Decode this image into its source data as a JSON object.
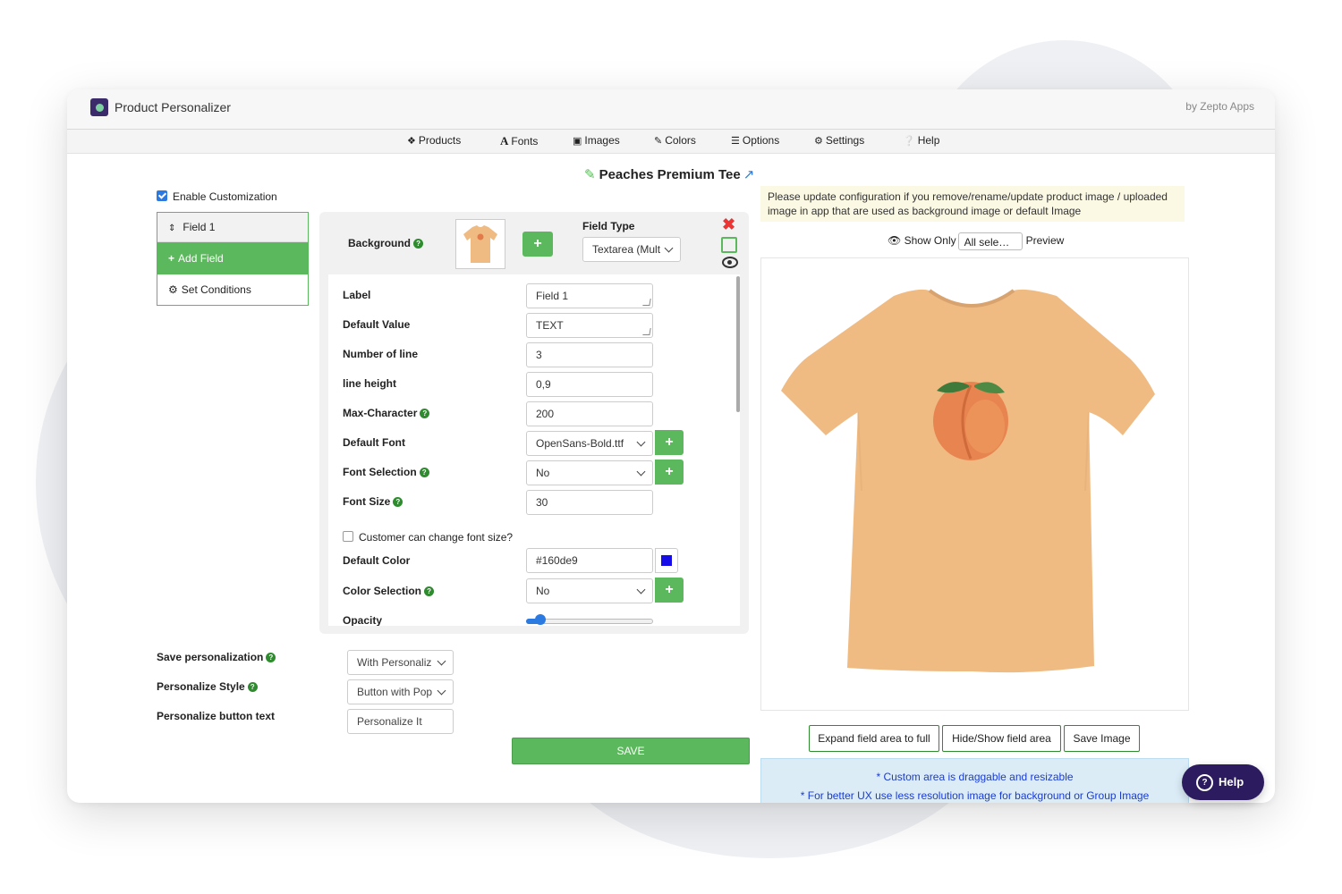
{
  "app": {
    "title": "Product Personalizer",
    "by": "by Zepto Apps"
  },
  "nav": {
    "items": [
      {
        "label": "Products",
        "icon": "cubes-icon"
      },
      {
        "label": "Fonts",
        "icon": "font-icon"
      },
      {
        "label": "Images",
        "icon": "image-icon"
      },
      {
        "label": "Colors",
        "icon": "brush-icon"
      },
      {
        "label": "Options",
        "icon": "list-icon"
      },
      {
        "label": "Settings",
        "icon": "gears-icon"
      },
      {
        "label": "Help",
        "icon": "question-circle-icon"
      }
    ]
  },
  "product": {
    "title": "Peaches Premium Tee"
  },
  "enable_customization": {
    "label": "Enable Customization",
    "checked": true
  },
  "fields_list": {
    "field": "Field 1",
    "add_field": "Add Field",
    "set_conditions": "Set Conditions"
  },
  "editor": {
    "background_label": "Background",
    "field_type_label": "Field Type",
    "field_type_value": "Textarea (Mult",
    "label": {
      "label": "Label",
      "value": "Field 1"
    },
    "default_value": {
      "label": "Default Value",
      "value": "TEXT"
    },
    "number_of_line": {
      "label": "Number of line",
      "value": "3"
    },
    "line_height": {
      "label": "line height",
      "value": "0,9"
    },
    "max_character": {
      "label": "Max-Character",
      "value": "200"
    },
    "default_font": {
      "label": "Default Font",
      "value": "OpenSans-Bold.ttf"
    },
    "font_selection": {
      "label": "Font Selection",
      "value": "No"
    },
    "font_size": {
      "label": "Font Size",
      "value": "30"
    },
    "change_font_size": {
      "label": "Customer can change font size?",
      "checked": false
    },
    "default_color": {
      "label": "Default Color",
      "value": "#160de9"
    },
    "color_selection": {
      "label": "Color Selection",
      "value": "No"
    },
    "opacity": {
      "label": "Opacity",
      "level": 0.08
    }
  },
  "settings": {
    "save_personalization": {
      "label": "Save personalization",
      "value": "With Personaliz"
    },
    "personalize_style": {
      "label": "Personalize Style",
      "value": "Button with Pop"
    },
    "personalize_button_text": {
      "label": "Personalize button text",
      "value": "Personalize It"
    }
  },
  "save_button": "SAVE",
  "preview": {
    "notice": "Please update configuration if you remove/rename/update product image / uploaded image in app that are used as background image or default Image",
    "show_only": "Show Only",
    "show_only_value": "All sele…",
    "preview_label": "Preview",
    "expand_button": "Expand field area to full",
    "hide_show_button": "Hide/Show field area",
    "save_image_button": "Save Image",
    "info_line1": "* Custom area is draggable and resizable",
    "info_line2": "* For better UX use less resolution image for background or Group Image"
  },
  "help_fab": "Help",
  "colors": {
    "accent_green": "#5cb85c",
    "shirt": "#efbb83",
    "default_color_swatch": "#160de9",
    "help_fab": "#2c1b5e"
  }
}
